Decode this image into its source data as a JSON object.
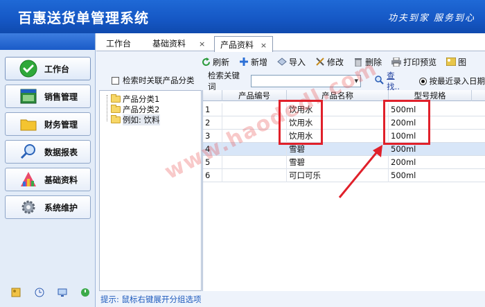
{
  "header": {
    "title": "百惠送货单管理系统",
    "slogan": "功夫到家  服务到心"
  },
  "nav": {
    "items": [
      {
        "label": "工作台",
        "icon": "check-circle-icon"
      },
      {
        "label": "销售管理",
        "icon": "sales-window-icon"
      },
      {
        "label": "财务管理",
        "icon": "folder-icon"
      },
      {
        "label": "数据报表",
        "icon": "magnifier-icon"
      },
      {
        "label": "基础资料",
        "icon": "chart-box-icon"
      },
      {
        "label": "系统维护",
        "icon": "gear-icon"
      }
    ],
    "active_index": 0
  },
  "tabs": [
    {
      "label": "工作台"
    },
    {
      "label": "基础资料"
    },
    {
      "label": "产品资料",
      "close": "×",
      "active": true
    }
  ],
  "tab_close_inactive": "×",
  "toolbar": {
    "items": [
      {
        "label": "刷新",
        "icon": "refresh-icon"
      },
      {
        "label": "新增",
        "icon": "add-icon"
      },
      {
        "label": "导入",
        "icon": "import-icon"
      },
      {
        "label": "修改",
        "icon": "edit-icon"
      },
      {
        "label": "删除",
        "icon": "trash-icon"
      },
      {
        "label": "打印预览",
        "icon": "print-icon"
      },
      {
        "label": "图",
        "icon": "image-icon"
      }
    ]
  },
  "category_panel": {
    "checkbox_label": "检索时关联产品分类",
    "tree": [
      {
        "label": "产品分类1"
      },
      {
        "label": "产品分类2"
      },
      {
        "label": "例如: 饮料",
        "selected": true
      }
    ],
    "hint": "提示: 鼠标右键展开分组选项"
  },
  "search": {
    "label": "检索关键词",
    "value": "",
    "button": "查找..",
    "radio_label": "按最近录入日期"
  },
  "grid": {
    "columns": [
      "产品编号",
      "产品名称",
      "型号规格"
    ],
    "rows": [
      {
        "no": "1",
        "code": "",
        "name": "饮用水",
        "spec": "500ml"
      },
      {
        "no": "2",
        "code": "",
        "name": "饮用水",
        "spec": "200ml"
      },
      {
        "no": "3",
        "code": "",
        "name": "饮用水",
        "spec": "100ml"
      },
      {
        "no": "4",
        "code": "",
        "name": "雪碧",
        "spec": "500ml"
      },
      {
        "no": "5",
        "code": "",
        "name": "雪碧",
        "spec": "200ml"
      },
      {
        "no": "6",
        "code": "",
        "name": "可口可乐",
        "spec": "500ml"
      }
    ],
    "highlight_row": 3
  },
  "watermark": "www.haodedl.com",
  "colors": {
    "header_blue": "#1557c4",
    "annotation_red": "#e0202a",
    "highlight_row": "#d8e6f8"
  }
}
